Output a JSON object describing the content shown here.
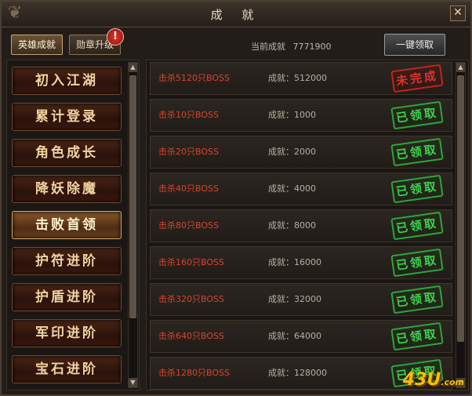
{
  "window": {
    "title": "成 就",
    "close_glyph": "✕"
  },
  "tabs": [
    {
      "label": "英雄成就",
      "active": true
    },
    {
      "label": "勋章升级",
      "active": false,
      "badge": "!"
    }
  ],
  "summary": {
    "total_label": "当前成就",
    "total_value": "7771900"
  },
  "claim_all_label": "一键领取",
  "categories": [
    {
      "label": "初入江湖",
      "active": false
    },
    {
      "label": "累计登录",
      "active": false
    },
    {
      "label": "角色成长",
      "active": false
    },
    {
      "label": "降妖除魔",
      "active": false
    },
    {
      "label": "击败首领",
      "active": true
    },
    {
      "label": "护符进阶",
      "active": false
    },
    {
      "label": "护盾进阶",
      "active": false
    },
    {
      "label": "军印进阶",
      "active": false
    },
    {
      "label": "宝石进阶",
      "active": false
    }
  ],
  "achievements": [
    {
      "task": "击杀5120只BOSS",
      "points": "成就：512000",
      "status": "未完成"
    },
    {
      "task": "击杀10只BOSS",
      "points": "成就：1000",
      "status": "已领取"
    },
    {
      "task": "击杀20只BOSS",
      "points": "成就：2000",
      "status": "已领取"
    },
    {
      "task": "击杀40只BOSS",
      "points": "成就：4000",
      "status": "已领取"
    },
    {
      "task": "击杀80只BOSS",
      "points": "成就：8000",
      "status": "已领取"
    },
    {
      "task": "击杀160只BOSS",
      "points": "成就：16000",
      "status": "已领取"
    },
    {
      "task": "击杀320只BOSS",
      "points": "成就：32000",
      "status": "已领取"
    },
    {
      "task": "击杀640只BOSS",
      "points": "成就：64000",
      "status": "已领取"
    },
    {
      "task": "击杀1280只BOSS",
      "points": "成就：128000",
      "status": "已领取"
    }
  ],
  "watermark": {
    "main": "43U",
    "suffix": ".com"
  },
  "colors": {
    "accent_gold": "#c9a36b",
    "task_red": "#d8452e",
    "claimed_green": "#3fd04d",
    "incomplete_red": "#e2332a",
    "watermark_yellow": "#f5c000"
  },
  "icons": {
    "scroll_up": "▲",
    "scroll_down": "▼",
    "corner_ornament": "❦"
  }
}
